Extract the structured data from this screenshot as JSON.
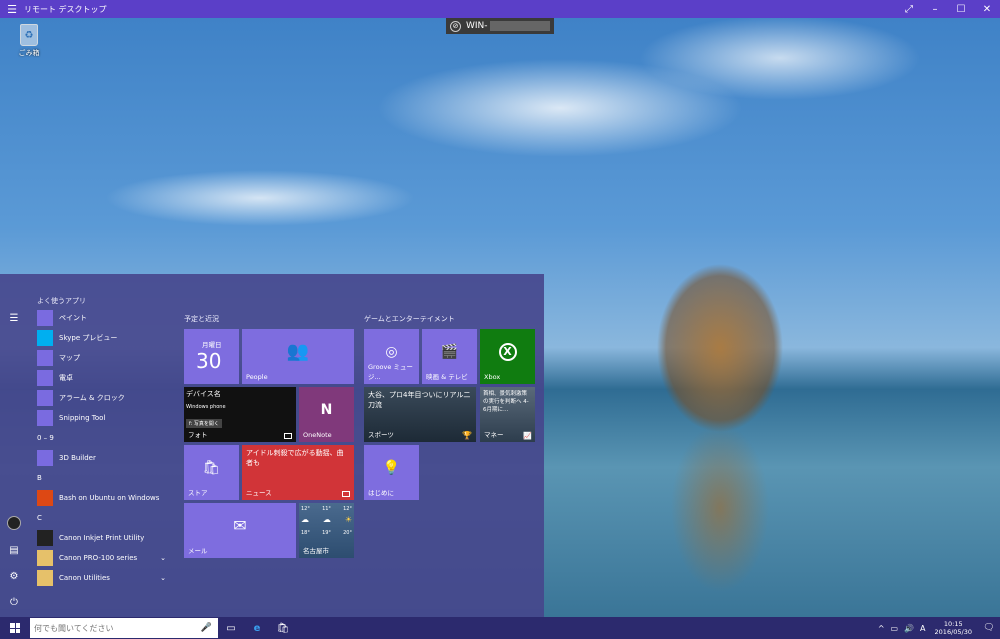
{
  "window": {
    "title": "リモート デスクトップ",
    "controls": [
      "⤢",
      "–",
      "☐",
      "✕"
    ]
  },
  "rdp_bar": {
    "host": "WIN-"
  },
  "desktop": {
    "recycle_bin_label": "ごみ箱"
  },
  "start": {
    "frequent_header": "よく使うアプリ",
    "frequent": [
      {
        "label": "ペイント",
        "icon": "paint-icon",
        "bg": "#7a6be0"
      },
      {
        "label": "Skype プレビュー",
        "icon": "skype-icon",
        "bg": "#00aff0"
      },
      {
        "label": "マップ",
        "icon": "maps-icon",
        "bg": "#7a6be0"
      },
      {
        "label": "電卓",
        "icon": "calculator-icon",
        "bg": "#7a6be0"
      },
      {
        "label": "アラーム & クロック",
        "icon": "alarm-icon",
        "bg": "#7a6be0"
      },
      {
        "label": "Snipping Tool",
        "icon": "scissors-icon",
        "bg": "#7a6be0"
      }
    ],
    "groups": [
      {
        "letter": "0 – 9",
        "apps": [
          {
            "label": "3D Builder",
            "icon": "cube-icon",
            "bg": "#7a6be0",
            "expand": false
          }
        ]
      },
      {
        "letter": "B",
        "apps": [
          {
            "label": "Bash on Ubuntu on Windows",
            "icon": "ubuntu-icon",
            "bg": "#dd4814",
            "expand": false
          }
        ]
      },
      {
        "letter": "C",
        "apps": [
          {
            "label": "Canon Inkjet Print Utility",
            "icon": "printer-icon",
            "bg": "#222",
            "expand": false
          },
          {
            "label": "Canon PRO-100 series",
            "icon": "folder-icon",
            "bg": "#e6c16a",
            "expand": true
          },
          {
            "label": "Canon Utilities",
            "icon": "folder-icon",
            "bg": "#e6c16a",
            "expand": true
          }
        ]
      }
    ],
    "tile_group_1": "予定と近況",
    "tile_group_2": "ゲームとエンターテイメント",
    "tiles": {
      "calendar": {
        "day_name": "月曜日",
        "day": "30"
      },
      "people": "People",
      "photos": {
        "label": "フォト",
        "device": "デバイス名",
        "sub1": "Windows phone",
        "sub2": "f: 写真を開く"
      },
      "onenote": "OneNote",
      "store": "ストア",
      "news": {
        "headline": "アイドル刺殺で広がる動揺、曲者も",
        "label": "ニュース"
      },
      "mail": "メール",
      "weather": {
        "days": [
          {
            "temp_hi": "12°",
            "temp_lo": "18°"
          },
          {
            "temp_hi": "11°",
            "temp_lo": "19°"
          },
          {
            "temp_hi": "12°",
            "temp_lo": "20°"
          }
        ],
        "city": "名古屋市"
      },
      "groove": "Groove ミュージ...",
      "movies": "映画 & テレビ",
      "xbox": "Xbox",
      "sports": {
        "headline": "大谷、プロ4年目ついにリアル二刀流",
        "label": "スポーツ"
      },
      "money": {
        "headline": "首相、景気刺激策の実行を判断へ 4-6月期に…",
        "label": "マネー"
      },
      "getstarted": "はじめに"
    }
  },
  "taskbar": {
    "search_placeholder": "何でも聞いてください",
    "time": "10:15",
    "date": "2016/05/30",
    "ime": "A"
  }
}
